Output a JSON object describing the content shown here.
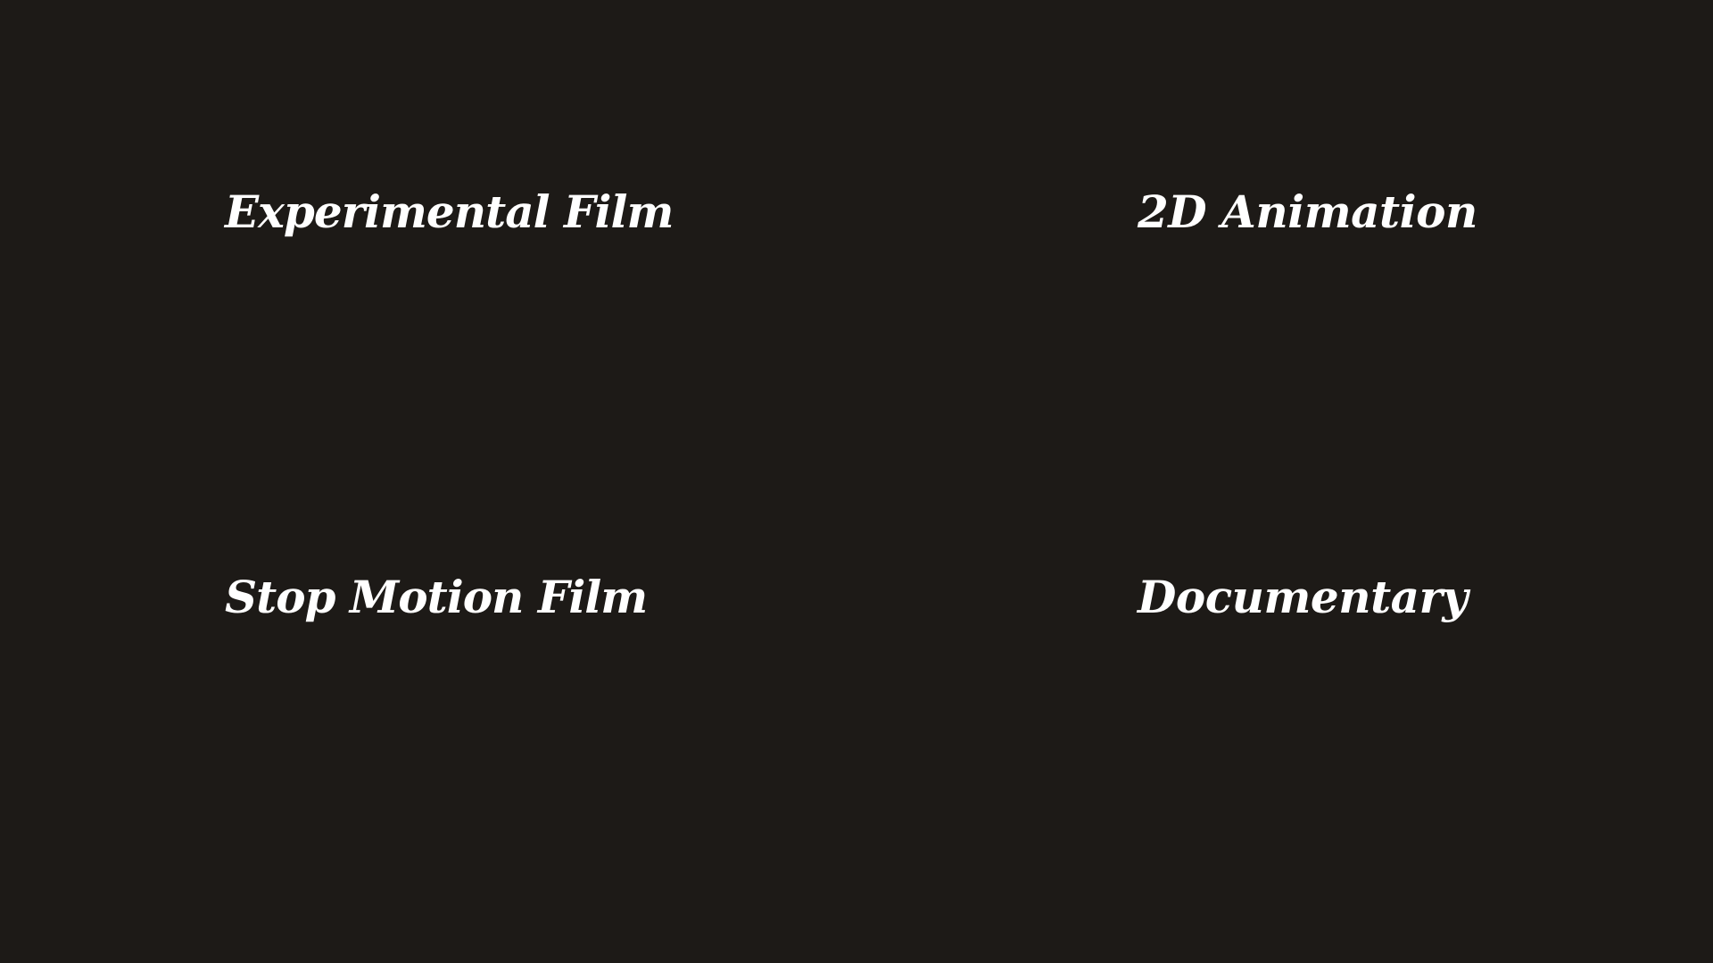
{
  "background_color": "#1d1a17",
  "text_color": "#ffffff",
  "categories": [
    {
      "label": "Experimental Film"
    },
    {
      "label": "2D Animation"
    },
    {
      "label": "Stop Motion Film"
    },
    {
      "label": "Documentary"
    }
  ]
}
